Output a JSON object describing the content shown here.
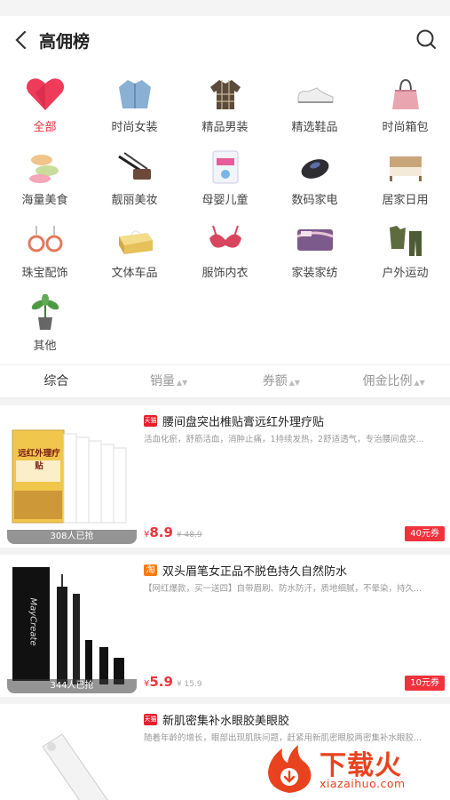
{
  "header": {
    "title": "高佣榜",
    "back_icon": "chevron-left-icon",
    "search_icon": "search-icon"
  },
  "categories": [
    {
      "label": "全部",
      "icon": "heart-icon",
      "active": true
    },
    {
      "label": "时尚女装",
      "icon": "jacket-icon"
    },
    {
      "label": "精品男装",
      "icon": "shirt-icon"
    },
    {
      "label": "精选鞋品",
      "icon": "shoe-icon"
    },
    {
      "label": "时尚箱包",
      "icon": "handbag-icon"
    },
    {
      "label": "海量美食",
      "icon": "macaron-icon"
    },
    {
      "label": "靓丽美妆",
      "icon": "cosmetics-icon"
    },
    {
      "label": "母婴儿童",
      "icon": "diaper-icon"
    },
    {
      "label": "数码家电",
      "icon": "mouse-icon"
    },
    {
      "label": "居家日用",
      "icon": "bed-icon"
    },
    {
      "label": "珠宝配饰",
      "icon": "earrings-icon"
    },
    {
      "label": "文体车品",
      "icon": "tissue-box-icon"
    },
    {
      "label": "服饰内衣",
      "icon": "bra-icon"
    },
    {
      "label": "家装家纺",
      "icon": "bedding-icon"
    },
    {
      "label": "户外运动",
      "icon": "outdoor-clothes-icon"
    },
    {
      "label": "其他",
      "icon": "plant-icon"
    }
  ],
  "sort": [
    "综合",
    "销量",
    "券额",
    "佣金比例"
  ],
  "products": [
    {
      "badge": "天猫",
      "name": "腰间盘突出椎贴膏远红外理疗贴",
      "desc": "活血化瘀，舒筋活血，消肿止痛，1持续发热，2舒适透气，专治腰间盘突...",
      "price_symbol": "¥",
      "price": "8.9",
      "orig": "¥ 48.9",
      "coupon": "40元券",
      "sold": "308人已抢",
      "box_text": "远红外理疗贴"
    },
    {
      "badge": "淘",
      "name": "双头眉笔女正品不脱色持久自然防水",
      "desc": "【网红爆款，买一送四】自带眉刷、防水防汗，质地细腻，不晕染，持久...",
      "price_symbol": "¥",
      "price": "5.9",
      "orig": "¥ 15.9",
      "coupon": "10元券",
      "sold": "344人已抢",
      "box_text": "MayCreate"
    },
    {
      "badge": "天猫",
      "name": "新肌密集补水眼胶美眼胶",
      "desc": "随着年龄的增长，眼部出现肌肤问题，赶紧用新肌密眼胶两密集补水眼胶..."
    }
  ],
  "watermark": {
    "big": "下载火",
    "small": "xiazaihuo.com"
  },
  "colors": {
    "accent": "#f0323c",
    "watermark": "#e8431e"
  }
}
